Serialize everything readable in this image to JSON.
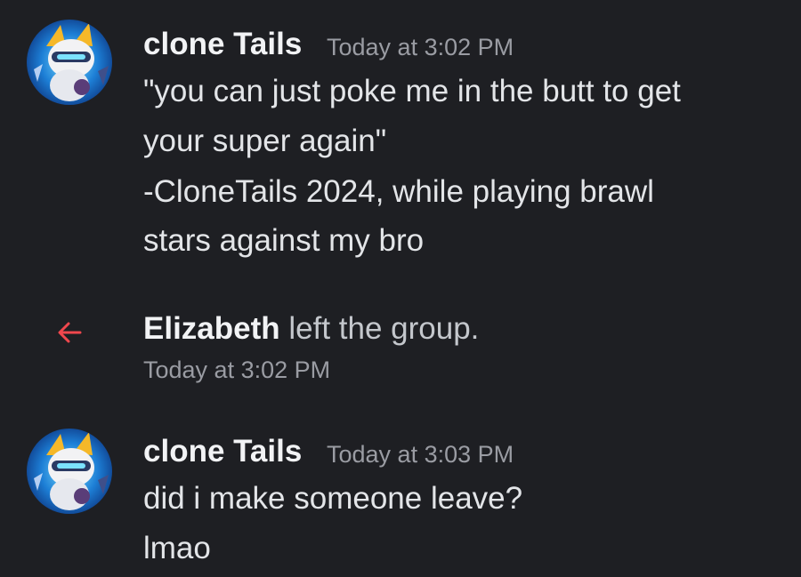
{
  "colors": {
    "background": "#1e1f23",
    "username": "#f2f3f5",
    "text": "#e3e5e8",
    "timestamp": "#9a9ca3",
    "leave_arrow": "#f0474d"
  },
  "messages": [
    {
      "author": "clone Tails",
      "timestamp": "Today at 3:02 PM",
      "avatar_icon": "fox-character-avatar",
      "lines": [
        "\"you can just poke me in the butt to get",
        "your super again\"",
        "-CloneTails 2024, while playing brawl",
        "stars against my bro"
      ]
    },
    {
      "author": "clone Tails",
      "timestamp": "Today at 3:03 PM",
      "avatar_icon": "fox-character-avatar",
      "lines": [
        "did i make someone leave?",
        "lmao"
      ]
    }
  ],
  "system_event": {
    "icon": "arrow-left-icon",
    "user": "Elizabeth",
    "action": " left the group.",
    "timestamp": "Today at 3:02 PM"
  }
}
